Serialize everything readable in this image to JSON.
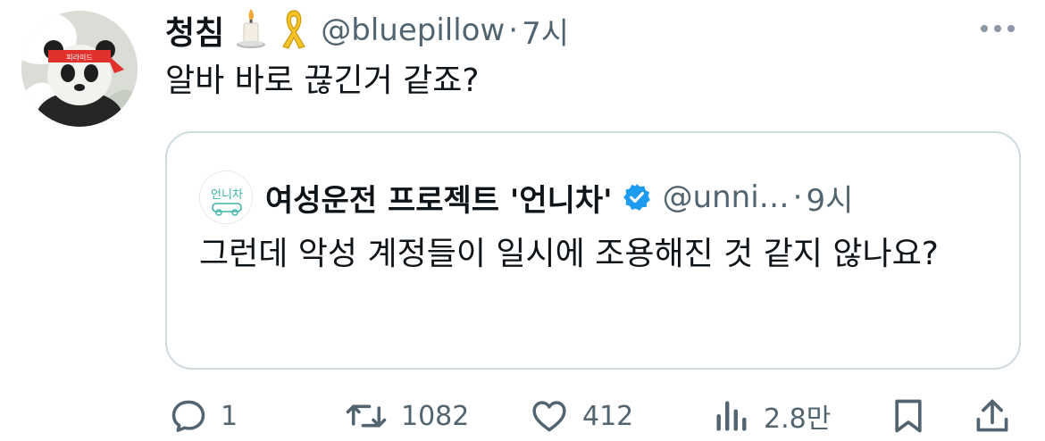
{
  "tweet": {
    "display_name": "청침",
    "emoji_badges": [
      "candle-icon",
      "yellow-ribbon-icon"
    ],
    "handle": "@bluepillow",
    "time": "7시",
    "text": "알바 바로 끊긴거 같죠?",
    "avatar_text": "피라미드"
  },
  "quoted": {
    "display_name": "여성운전 프로젝트 '언니차'",
    "avatar_text": "언니차",
    "verified_icon": "verified-badge-icon",
    "handle": "@unni…",
    "time": "9시",
    "text": "그런데 악성 계정들이 일시에 조용해진 것 같지 않나요?"
  },
  "actions": {
    "reply_count": "1",
    "retweet_count": "1082",
    "like_count": "412",
    "views_count": "2.8만"
  },
  "colors": {
    "text_primary": "#0f1419",
    "text_secondary": "#536471",
    "border": "#cfd9de",
    "verified": "#1d9bf0",
    "ribbon": "#f7c325"
  }
}
